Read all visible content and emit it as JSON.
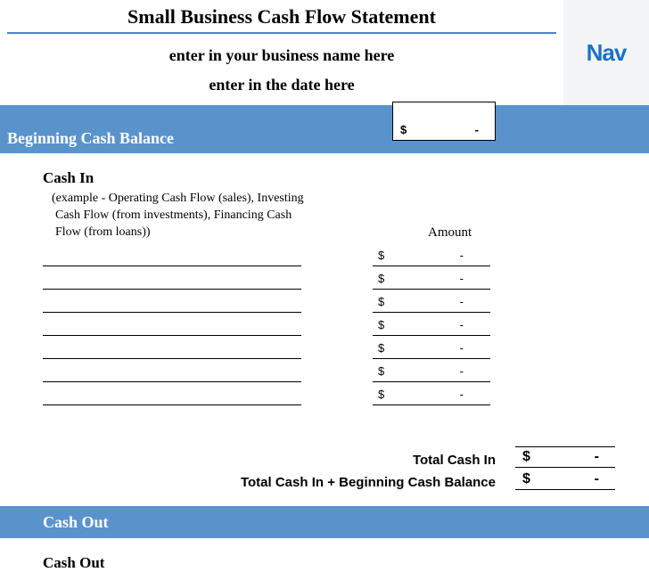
{
  "header": {
    "title": "Small Business Cash Flow Statement",
    "business_placeholder": "enter in your business name here",
    "date_placeholder": "enter in the date here",
    "logo_text": "Nav"
  },
  "beginning": {
    "heading": "Beginning Cash Balance",
    "currency": "$",
    "value": "-"
  },
  "cash_in": {
    "heading": "Cash In",
    "example": "(example - Operating Cash Flow (sales), Investing Cash Flow (from investments), Financing Cash Flow (from loans))",
    "amount_heading": "Amount",
    "rows": [
      {
        "desc": "",
        "currency": "$",
        "value": "-"
      },
      {
        "desc": "",
        "currency": "$",
        "value": "-"
      },
      {
        "desc": "",
        "currency": "$",
        "value": "-"
      },
      {
        "desc": "",
        "currency": "$",
        "value": "-"
      },
      {
        "desc": "",
        "currency": "$",
        "value": "-"
      },
      {
        "desc": "",
        "currency": "$",
        "value": "-"
      },
      {
        "desc": "",
        "currency": "$",
        "value": "-"
      }
    ]
  },
  "totals": {
    "total_in_label": "Total Cash In",
    "total_in_currency": "$",
    "total_in_value": "-",
    "total_combined_label": "Total Cash In + Beginning Cash Balance",
    "total_combined_currency": "$",
    "total_combined_value": "-"
  },
  "cash_out": {
    "heading": "Cash Out",
    "sub_heading": "Cash Out"
  }
}
